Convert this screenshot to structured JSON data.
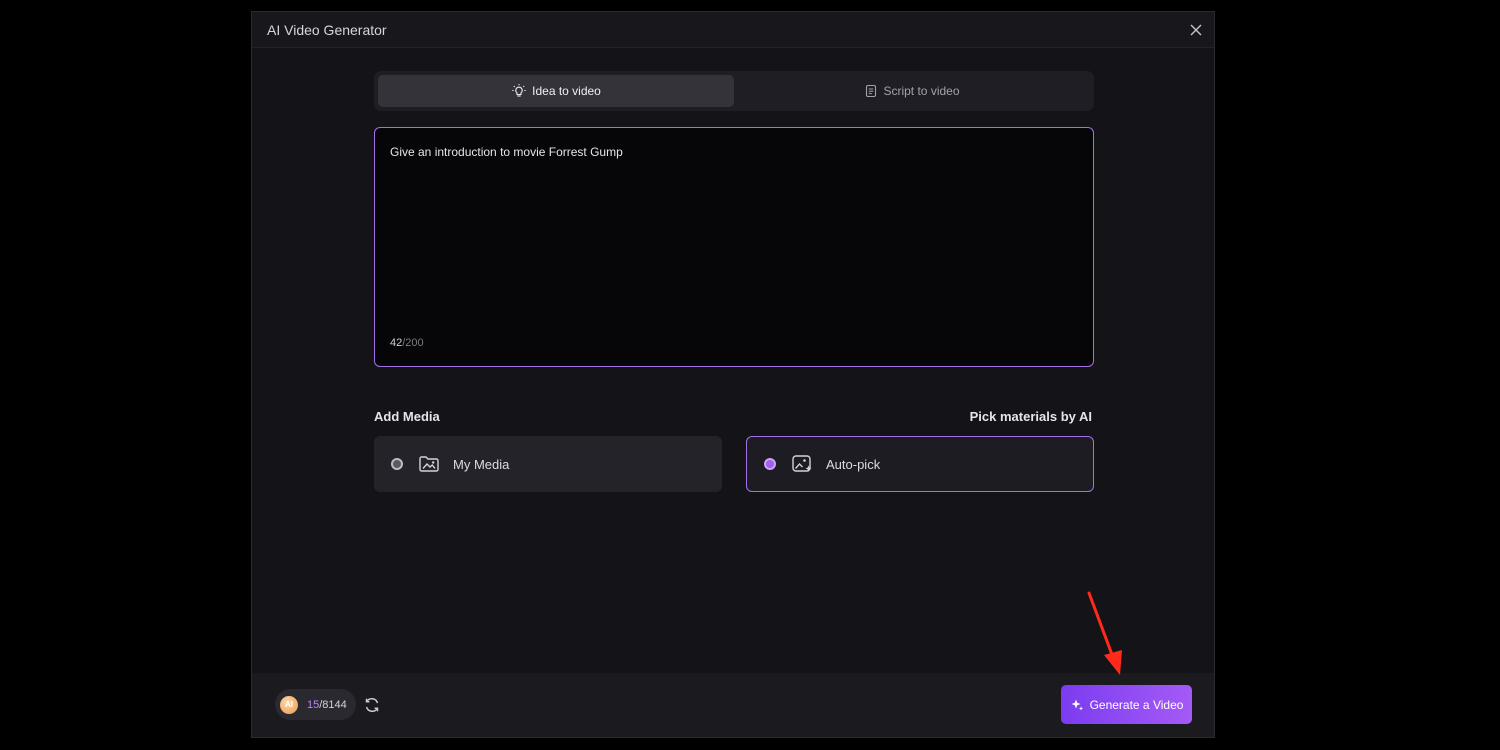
{
  "window": {
    "title": "AI Video Generator",
    "close_icon": "close-icon"
  },
  "tabs": [
    {
      "label": "Idea to video",
      "icon": "lightbulb-icon",
      "active": true
    },
    {
      "label": "Script to video",
      "icon": "document-icon",
      "active": false
    }
  ],
  "prompt": {
    "value": "Give an introduction to movie Forrest Gump",
    "char_count": "42",
    "char_limit": "/200"
  },
  "media": {
    "add_label": "Add Media",
    "pick_label": "Pick materials by AI",
    "options": [
      {
        "label": "My Media",
        "icon": "folder-image-icon",
        "selected": false
      },
      {
        "label": "Auto-pick",
        "icon": "ai-image-icon",
        "selected": true
      }
    ]
  },
  "footer": {
    "coin_label": "AI",
    "credits_used": "15",
    "credits_total": "/8144",
    "generate_label": "Generate a Video"
  },
  "colors": {
    "accent": "#a470e8",
    "button_start": "#7b3cf0",
    "button_end": "#a55af6",
    "annotation_arrow": "#ff2a1a"
  }
}
